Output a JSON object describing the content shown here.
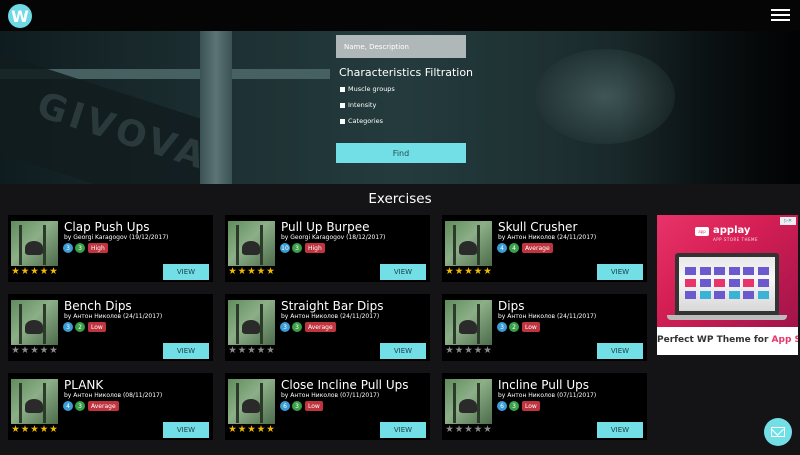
{
  "header": {
    "logo_letter": "W",
    "menu_icon": "hamburger-icon"
  },
  "search": {
    "placeholder": "Name, Description",
    "filter_title": "Characteristics Filtration",
    "options": [
      "Muscle groups",
      "Intensity",
      "Categories"
    ],
    "find_label": "Find"
  },
  "section_title": "Exercises",
  "exercises": [
    {
      "title": "Clap Push Ups",
      "author": "by Georgi Karagogov (19/12/2017)",
      "n1": "3",
      "n2": "3",
      "level": "High",
      "rating": 5,
      "view_label": "VIEW"
    },
    {
      "title": "Pull Up Burpee",
      "author": "by Georgi Karagogov (18/12/2017)",
      "n1": "10",
      "n2": "3",
      "level": "High",
      "rating": 5,
      "view_label": "VIEW"
    },
    {
      "title": "Skull Crusher",
      "author": "by Антон Николов (24/11/2017)",
      "n1": "4",
      "n2": "4",
      "level": "Average",
      "rating": 5,
      "view_label": "VIEW"
    },
    {
      "title": "Bench Dips",
      "author": "by Антон Николов (24/11/2017)",
      "n1": "3",
      "n2": "2",
      "level": "Low",
      "rating": 0,
      "view_label": "VIEW"
    },
    {
      "title": "Straight Bar Dips",
      "author": "by Антон Николов (24/11/2017)",
      "n1": "3",
      "n2": "3",
      "level": "Average",
      "rating": 0,
      "view_label": "VIEW"
    },
    {
      "title": "Dips",
      "author": "by Антон Николов (24/11/2017)",
      "n1": "3",
      "n2": "2",
      "level": "Low",
      "rating": 0,
      "view_label": "VIEW"
    },
    {
      "title": "PLANK",
      "author": "by Антон Николов (08/11/2017)",
      "n1": "4",
      "n2": "3",
      "level": "Average",
      "rating": 5,
      "view_label": "VIEW"
    },
    {
      "title": "Close Incline Pull Ups",
      "author": "by Антон Николов (07/11/2017)",
      "n1": "6",
      "n2": "3",
      "level": "Low",
      "rating": 5,
      "view_label": "VIEW"
    },
    {
      "title": "Incline Pull Ups",
      "author": "by Антон Николов (07/11/2017)",
      "n1": "6",
      "n2": "3",
      "level": "Low",
      "rating": 0,
      "view_label": "VIEW"
    }
  ],
  "ad": {
    "brand": "applay",
    "brand_sub": "APP STORE THEME",
    "app_icon_text": "app",
    "badge": "▷✕",
    "text_prefix": "Perfect WP Theme ",
    "text_for": "for ",
    "text_highlight": "App Store"
  },
  "colors": {
    "accent": "#72dfe6",
    "high": "#c0343f",
    "star_gold": "#f2b900",
    "star_grey": "#8a8a8a"
  }
}
